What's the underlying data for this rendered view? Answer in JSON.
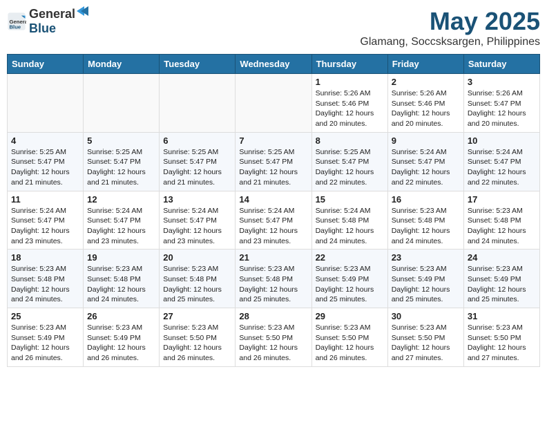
{
  "header": {
    "logo_general": "General",
    "logo_blue": "Blue",
    "month": "May 2025",
    "location": "Glamang, Soccsksargen, Philippines"
  },
  "weekdays": [
    "Sunday",
    "Monday",
    "Tuesday",
    "Wednesday",
    "Thursday",
    "Friday",
    "Saturday"
  ],
  "weeks": [
    [
      {
        "day": "",
        "info": ""
      },
      {
        "day": "",
        "info": ""
      },
      {
        "day": "",
        "info": ""
      },
      {
        "day": "",
        "info": ""
      },
      {
        "day": "1",
        "info": "Sunrise: 5:26 AM\nSunset: 5:46 PM\nDaylight: 12 hours\nand 20 minutes."
      },
      {
        "day": "2",
        "info": "Sunrise: 5:26 AM\nSunset: 5:46 PM\nDaylight: 12 hours\nand 20 minutes."
      },
      {
        "day": "3",
        "info": "Sunrise: 5:26 AM\nSunset: 5:47 PM\nDaylight: 12 hours\nand 20 minutes."
      }
    ],
    [
      {
        "day": "4",
        "info": "Sunrise: 5:25 AM\nSunset: 5:47 PM\nDaylight: 12 hours\nand 21 minutes."
      },
      {
        "day": "5",
        "info": "Sunrise: 5:25 AM\nSunset: 5:47 PM\nDaylight: 12 hours\nand 21 minutes."
      },
      {
        "day": "6",
        "info": "Sunrise: 5:25 AM\nSunset: 5:47 PM\nDaylight: 12 hours\nand 21 minutes."
      },
      {
        "day": "7",
        "info": "Sunrise: 5:25 AM\nSunset: 5:47 PM\nDaylight: 12 hours\nand 21 minutes."
      },
      {
        "day": "8",
        "info": "Sunrise: 5:25 AM\nSunset: 5:47 PM\nDaylight: 12 hours\nand 22 minutes."
      },
      {
        "day": "9",
        "info": "Sunrise: 5:24 AM\nSunset: 5:47 PM\nDaylight: 12 hours\nand 22 minutes."
      },
      {
        "day": "10",
        "info": "Sunrise: 5:24 AM\nSunset: 5:47 PM\nDaylight: 12 hours\nand 22 minutes."
      }
    ],
    [
      {
        "day": "11",
        "info": "Sunrise: 5:24 AM\nSunset: 5:47 PM\nDaylight: 12 hours\nand 23 minutes."
      },
      {
        "day": "12",
        "info": "Sunrise: 5:24 AM\nSunset: 5:47 PM\nDaylight: 12 hours\nand 23 minutes."
      },
      {
        "day": "13",
        "info": "Sunrise: 5:24 AM\nSunset: 5:47 PM\nDaylight: 12 hours\nand 23 minutes."
      },
      {
        "day": "14",
        "info": "Sunrise: 5:24 AM\nSunset: 5:47 PM\nDaylight: 12 hours\nand 23 minutes."
      },
      {
        "day": "15",
        "info": "Sunrise: 5:24 AM\nSunset: 5:48 PM\nDaylight: 12 hours\nand 24 minutes."
      },
      {
        "day": "16",
        "info": "Sunrise: 5:23 AM\nSunset: 5:48 PM\nDaylight: 12 hours\nand 24 minutes."
      },
      {
        "day": "17",
        "info": "Sunrise: 5:23 AM\nSunset: 5:48 PM\nDaylight: 12 hours\nand 24 minutes."
      }
    ],
    [
      {
        "day": "18",
        "info": "Sunrise: 5:23 AM\nSunset: 5:48 PM\nDaylight: 12 hours\nand 24 minutes."
      },
      {
        "day": "19",
        "info": "Sunrise: 5:23 AM\nSunset: 5:48 PM\nDaylight: 12 hours\nand 24 minutes."
      },
      {
        "day": "20",
        "info": "Sunrise: 5:23 AM\nSunset: 5:48 PM\nDaylight: 12 hours\nand 25 minutes."
      },
      {
        "day": "21",
        "info": "Sunrise: 5:23 AM\nSunset: 5:48 PM\nDaylight: 12 hours\nand 25 minutes."
      },
      {
        "day": "22",
        "info": "Sunrise: 5:23 AM\nSunset: 5:49 PM\nDaylight: 12 hours\nand 25 minutes."
      },
      {
        "day": "23",
        "info": "Sunrise: 5:23 AM\nSunset: 5:49 PM\nDaylight: 12 hours\nand 25 minutes."
      },
      {
        "day": "24",
        "info": "Sunrise: 5:23 AM\nSunset: 5:49 PM\nDaylight: 12 hours\nand 25 minutes."
      }
    ],
    [
      {
        "day": "25",
        "info": "Sunrise: 5:23 AM\nSunset: 5:49 PM\nDaylight: 12 hours\nand 26 minutes."
      },
      {
        "day": "26",
        "info": "Sunrise: 5:23 AM\nSunset: 5:49 PM\nDaylight: 12 hours\nand 26 minutes."
      },
      {
        "day": "27",
        "info": "Sunrise: 5:23 AM\nSunset: 5:50 PM\nDaylight: 12 hours\nand 26 minutes."
      },
      {
        "day": "28",
        "info": "Sunrise: 5:23 AM\nSunset: 5:50 PM\nDaylight: 12 hours\nand 26 minutes."
      },
      {
        "day": "29",
        "info": "Sunrise: 5:23 AM\nSunset: 5:50 PM\nDaylight: 12 hours\nand 26 minutes."
      },
      {
        "day": "30",
        "info": "Sunrise: 5:23 AM\nSunset: 5:50 PM\nDaylight: 12 hours\nand 27 minutes."
      },
      {
        "day": "31",
        "info": "Sunrise: 5:23 AM\nSunset: 5:50 PM\nDaylight: 12 hours\nand 27 minutes."
      }
    ]
  ]
}
